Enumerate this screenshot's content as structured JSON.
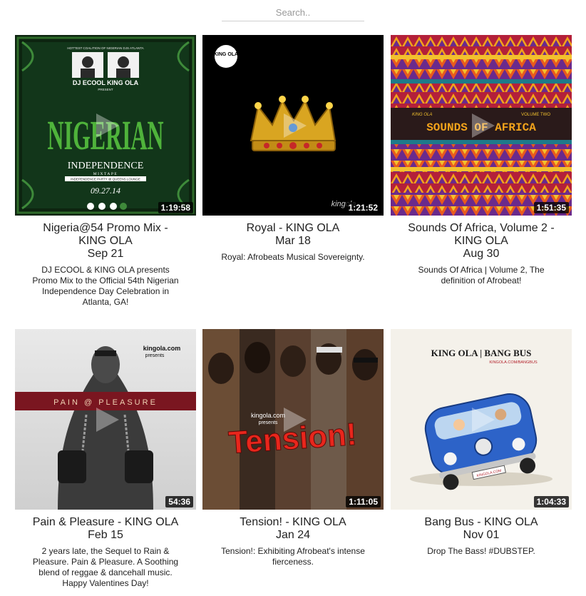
{
  "search": {
    "placeholder": "Search.."
  },
  "cards": [
    {
      "title": "Nigeria@54 Promo Mix - KING OLA",
      "date": "Sep 21",
      "duration": "1:19:58",
      "description": "DJ ECOOL & KING OLA presents Promo Mix to the Official 54th Nigerian Independence Day Celebration in Atlanta, GA!",
      "art": {
        "top": "HOTTEST COALITION OF NIGERIAN DJS ATLANTA",
        "names": "DJ ECOOL KING OLA",
        "presents": "PRESENT",
        "main": "NIGERIAN",
        "sub": "INDEPENDENCE",
        "mix": "MIXTAPE",
        "tag": "INDEPENDENCE PARTY @ QUEENS LOUNGE",
        "date": "09.27.14"
      }
    },
    {
      "title": "Royal - KING OLA",
      "date": "Mar 18",
      "duration": "1:21:52",
      "description": "Royal: Afrobeats Musical Sovereignty.",
      "art": {
        "logo": "KING OLA",
        "brand": "kingola"
      }
    },
    {
      "title": "Sounds Of Africa, Volume 2 - KING OLA",
      "date": "Aug 30",
      "duration": "1:51:35",
      "description": "Sounds Of Africa | Volume 2, The definition of Afrobeat!",
      "art": {
        "left": "KING OLA",
        "right": "VOLUME TWO",
        "main": "SOUNDS OF AFRICA"
      }
    },
    {
      "title": "Pain & Pleasure - KING OLA",
      "date": "Feb 15",
      "duration": "54:36",
      "description": "2 years late, the Sequel to Rain & Pleasure. Pain & Pleasure. A Soothing blend of reggae & dancehall music. Happy Valentines Day!",
      "art": {
        "brand": "kingola.com",
        "presents": "presents",
        "banner": "PAIN @ PLEASURE"
      }
    },
    {
      "title": "Tension! - KING OLA",
      "date": "Jan 24",
      "duration": "1:11:05",
      "description": "Tension!: Exhibiting Afrobeat's intense fierceness.",
      "art": {
        "brand": "kingola.com",
        "presents": "presents",
        "main": "Tension!"
      }
    },
    {
      "title": "Bang Bus - KING OLA",
      "date": "Nov 01",
      "duration": "1:04:33",
      "description": "Drop The Bass! #DUBSTEP.",
      "art": {
        "header": "KING OLA | BANG BUS",
        "url": "KINGOLA.COM/BANGBUS",
        "plate": "KINGOLA.COM"
      }
    }
  ],
  "icons": {
    "play": "play-icon"
  },
  "colors": {
    "overlay": "#000000",
    "text": "#222222",
    "searchLine": "#d0d0d0"
  }
}
